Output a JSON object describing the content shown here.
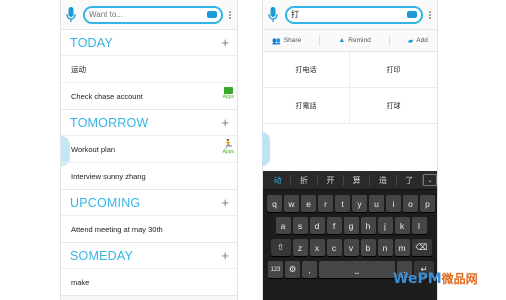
{
  "left": {
    "search_placeholder": "Want to...",
    "sections": [
      {
        "title": "TODAY",
        "items": [
          {
            "text": "运动",
            "tag": ""
          },
          {
            "text": "Check chase account",
            "tag": "Apps"
          }
        ]
      },
      {
        "title": "TOMORROW",
        "items": [
          {
            "text": "Workout plan",
            "tag": "Apps"
          },
          {
            "text": "Interview sunny zhang",
            "tag": ""
          }
        ]
      },
      {
        "title": "UPCOMING",
        "items": [
          {
            "text": "Attend meeting at may 30th",
            "tag": ""
          }
        ]
      },
      {
        "title": "SOMEDAY",
        "items": [
          {
            "text": "make",
            "tag": ""
          }
        ]
      }
    ],
    "plus": "+"
  },
  "right": {
    "search_value": "打",
    "actions": {
      "share": "Share",
      "remind": "Remind",
      "add": "Add"
    },
    "suggestions": [
      "打电话",
      "打印",
      "打電話",
      "打球"
    ],
    "candidates": [
      "动",
      "折",
      "开",
      "算",
      "造",
      "了"
    ],
    "expand": "⌄",
    "keys": {
      "row1": [
        "q",
        "w",
        "e",
        "r",
        "t",
        "y",
        "u",
        "i",
        "o",
        "p"
      ],
      "row2": [
        "a",
        "s",
        "d",
        "f",
        "g",
        "h",
        "j",
        "k",
        "l"
      ],
      "row3": [
        "z",
        "x",
        "c",
        "v",
        "b",
        "n",
        "m"
      ],
      "special": {
        "shift": "⇧",
        "del": "⌫",
        "num": "123",
        "settings": "⚙",
        "comma": ",",
        "space": "⎵",
        "period": ".",
        "enter": "↵",
        "symbols": "?123"
      }
    }
  },
  "watermark": {
    "main": "WePM",
    "sub": "微品网"
  },
  "colors": {
    "accent": "#33b5e5",
    "apps_green": "#3aa829",
    "keyboard_bg": "#1d1d1d"
  }
}
